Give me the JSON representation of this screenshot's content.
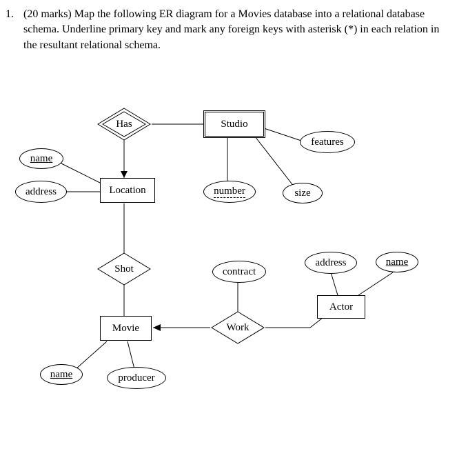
{
  "question": {
    "number": "1.",
    "marks": "(20 marks)",
    "text": "Map the following ER diagram for a Movies database into a relational database schema. Underline primary key and mark any foreign keys with asterisk (*) in each relation in the resultant relational schema."
  },
  "er": {
    "entities": {
      "studio": "Studio",
      "location": "Location",
      "movie": "Movie",
      "actor": "Actor"
    },
    "relationships": {
      "has": "Has",
      "shot": "Shot",
      "work": "Work"
    },
    "attributes": {
      "loc_name": "name",
      "loc_address": "address",
      "studio_number": "number",
      "studio_size": "size",
      "studio_features": "features",
      "work_contract": "contract",
      "actor_address": "address",
      "actor_name": "name",
      "movie_name": "name",
      "movie_producer": "producer"
    }
  }
}
